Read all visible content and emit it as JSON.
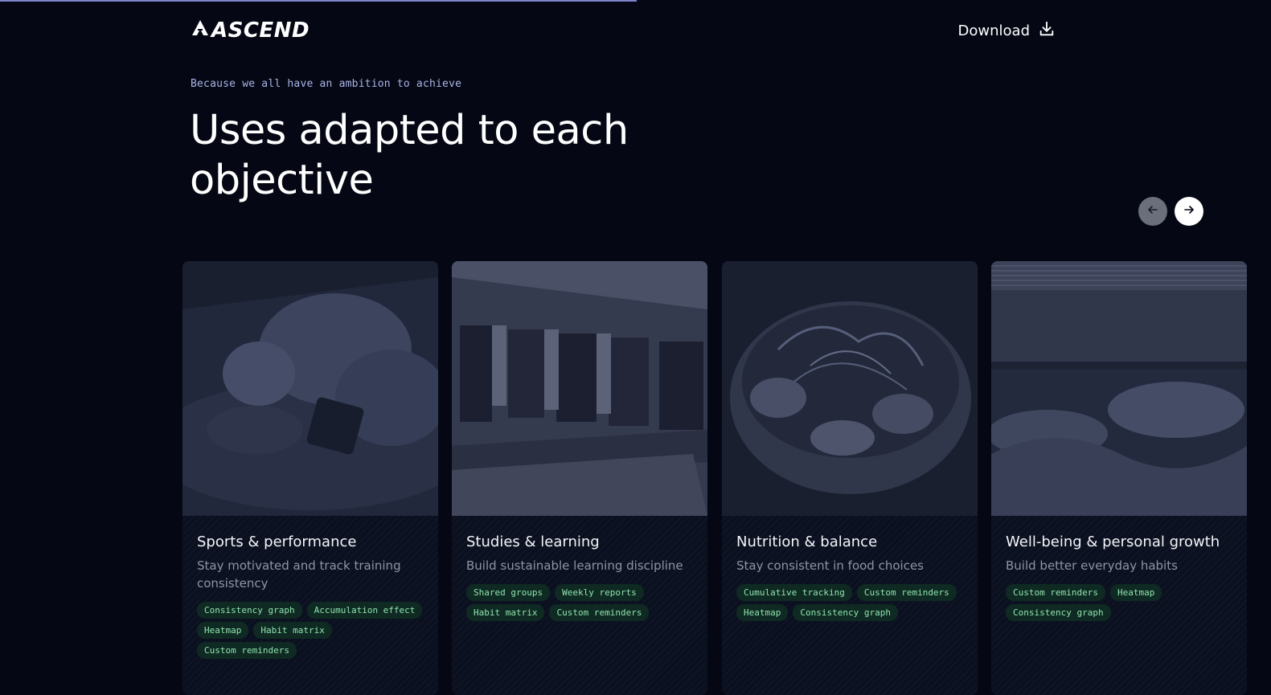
{
  "brand": {
    "name": "ASCEND",
    "logo_icon": "mountain-arrow-icon"
  },
  "header": {
    "download_label": "Download",
    "download_icon": "download-icon"
  },
  "hero": {
    "eyebrow": "Because we all have an ambition to achieve",
    "title": "Uses adapted to each objective"
  },
  "carousel": {
    "prev_icon": "arrow-left-icon",
    "next_icon": "arrow-right-icon"
  },
  "cards": [
    {
      "title": "Sports & performance",
      "subtitle": "Stay motivated and track training consistency",
      "tags": [
        "Consistency graph",
        "Accumulation effect",
        "Heatmap",
        "Habit matrix",
        "Custom reminders"
      ]
    },
    {
      "title": "Studies & learning",
      "subtitle": "Build sustainable learning discipline",
      "tags": [
        "Shared groups",
        "Weekly reports",
        "Habit matrix",
        "Custom reminders"
      ]
    },
    {
      "title": "Nutrition & balance",
      "subtitle": "Stay consistent in food choices",
      "tags": [
        "Cumulative tracking",
        "Custom reminders",
        "Heatmap",
        "Consistency graph"
      ]
    },
    {
      "title": "Well-being & personal growth",
      "subtitle": "Build better everyday habits",
      "tags": [
        "Custom reminders",
        "Heatmap",
        "Consistency graph"
      ]
    }
  ],
  "colors": {
    "background": "#050814",
    "tag_text": "#8fe3b0",
    "tag_bg": "#0f2a22",
    "eyebrow": "#a9b4e6"
  }
}
